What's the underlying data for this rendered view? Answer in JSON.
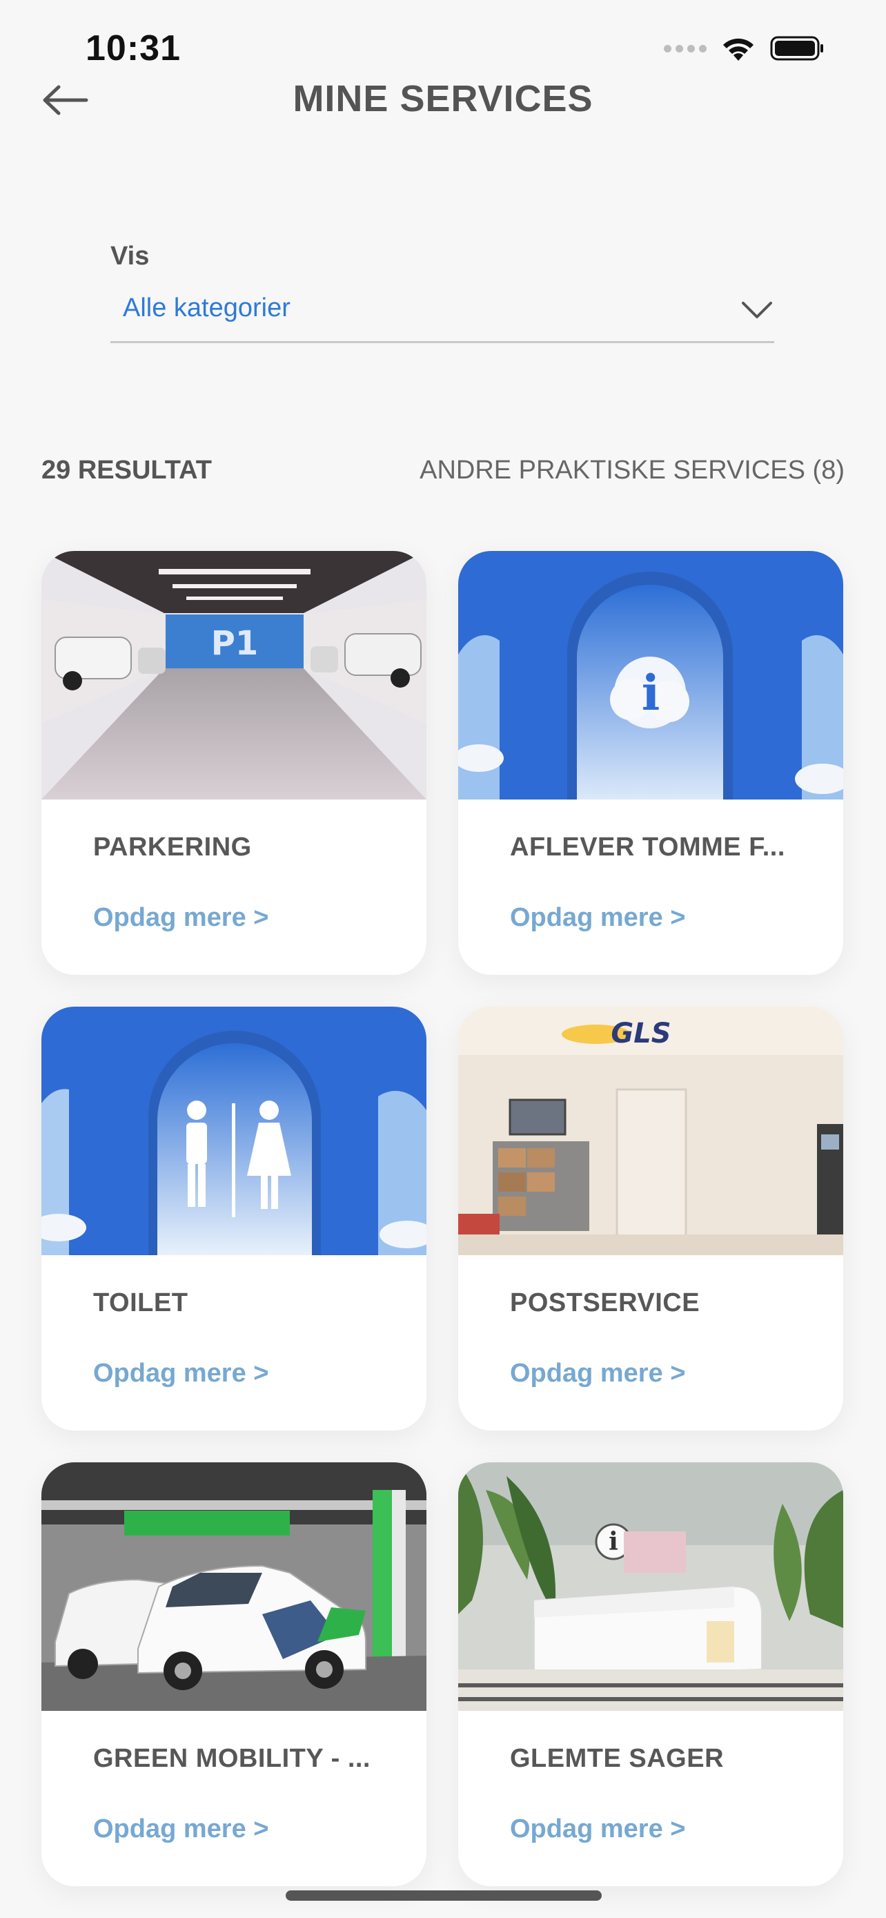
{
  "status_bar": {
    "time": "10:31",
    "icons": [
      "cellular-signal-icon",
      "wifi-icon",
      "battery-icon"
    ]
  },
  "header": {
    "title": "MINE SERVICES",
    "back_icon": "arrow-left-icon"
  },
  "filter": {
    "label": "Vis",
    "selected_value": "Alle kategorier",
    "icon": "chevron-down-icon"
  },
  "results": {
    "count_label": "29 RESULTAT",
    "other_services_label": "ANDRE PRAKTISKE SERVICES (8)"
  },
  "cards": [
    {
      "title": "PARKERING",
      "link": "Opdag mere >",
      "image": "parking-garage-photo"
    },
    {
      "title": "AFLEVER TOMME F...",
      "link": "Opdag mere >",
      "image": "info-arch-photo"
    },
    {
      "title": "TOILET",
      "link": "Opdag mere >",
      "image": "toilet-arch-photo"
    },
    {
      "title": "POSTSERVICE",
      "link": "Opdag mere >",
      "image": "gls-postservice-photo"
    },
    {
      "title": "GREEN MOBILITY - ...",
      "link": "Opdag mere >",
      "image": "green-mobility-cars-photo"
    },
    {
      "title": "GLEMTE SAGER",
      "link": "Opdag mere >",
      "image": "info-desk-photo"
    }
  ],
  "colors": {
    "accent_blue": "#2e7ad8",
    "link_blue": "#76a8d2",
    "title_gray": "#545454",
    "background": "#f7f7f7"
  }
}
